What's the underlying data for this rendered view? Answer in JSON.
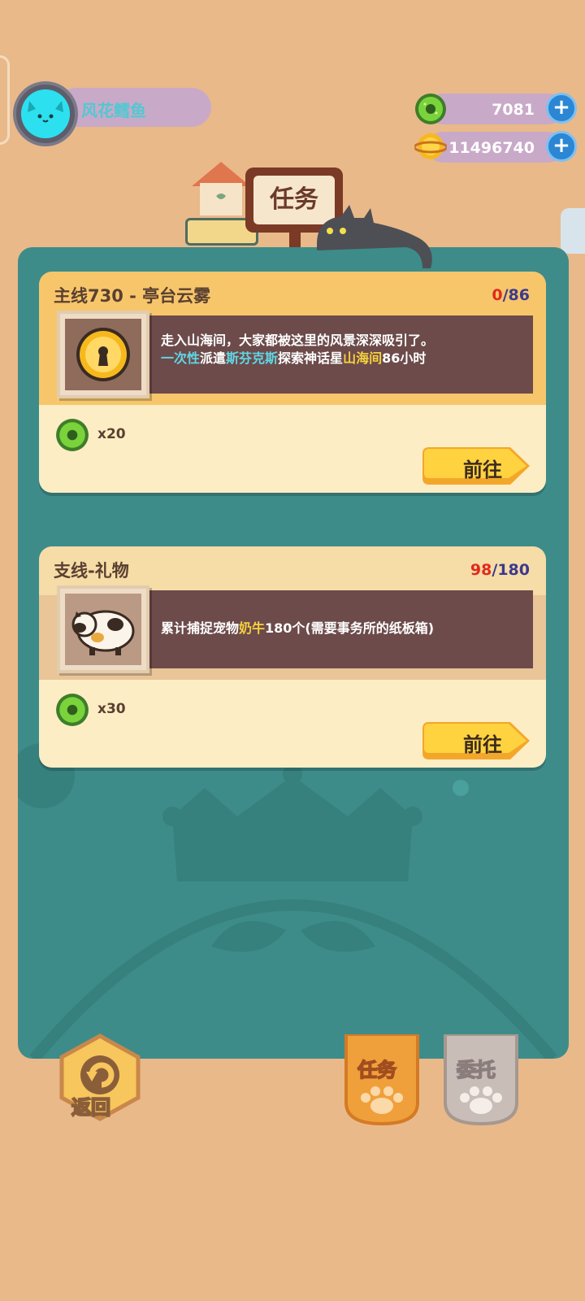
{
  "player": {
    "name": "风花鳕鱼"
  },
  "currency": [
    {
      "icon": "green-donut-coin-icon",
      "value": "7081"
    },
    {
      "icon": "gold-planet-coin-icon",
      "value": "11496740"
    }
  ],
  "header": {
    "sign_label": "任务"
  },
  "quests": [
    {
      "title": "主线730 - 亭台云雾",
      "progress_current": "0",
      "progress_slash": "/",
      "progress_total": "86",
      "desc_line1": "走入山海间，大家都被这里的风景深深吸引了。",
      "desc_line2": {
        "p1": "一次性",
        "p2": "派遣",
        "p3": "斯芬克斯",
        "p4": "探索神话星",
        "p5": "山海间",
        "p6": "86小时"
      },
      "thumb_icon": "golden-keyhole-medal-icon",
      "reward_icon": "green-donut-coin-icon",
      "reward_qty": "x20",
      "button_label": "前往"
    },
    {
      "title": "支线-礼物",
      "progress_current": "98",
      "progress_slash": "/",
      "progress_total": "180",
      "desc": {
        "p1": "累计捕捉宠物",
        "p2": "奶牛",
        "p3": "180个(需要事务所的纸板箱)"
      },
      "thumb_icon": "cow-pet-icon",
      "reward_icon": "green-donut-coin-icon",
      "reward_qty": "x30",
      "button_label": "前往"
    }
  ],
  "bottom": {
    "back_label": "返回",
    "tabs": [
      {
        "label": "任务",
        "active": true
      },
      {
        "label": "委托",
        "active": false
      }
    ]
  },
  "colors": {
    "background": "#e9b98a",
    "panel": "#3d8c8a",
    "highlight_cyan": "#5fd8e6",
    "highlight_yellow": "#f6d23e",
    "progress_red": "#e02a1d",
    "progress_navy": "#3c3a8c"
  }
}
